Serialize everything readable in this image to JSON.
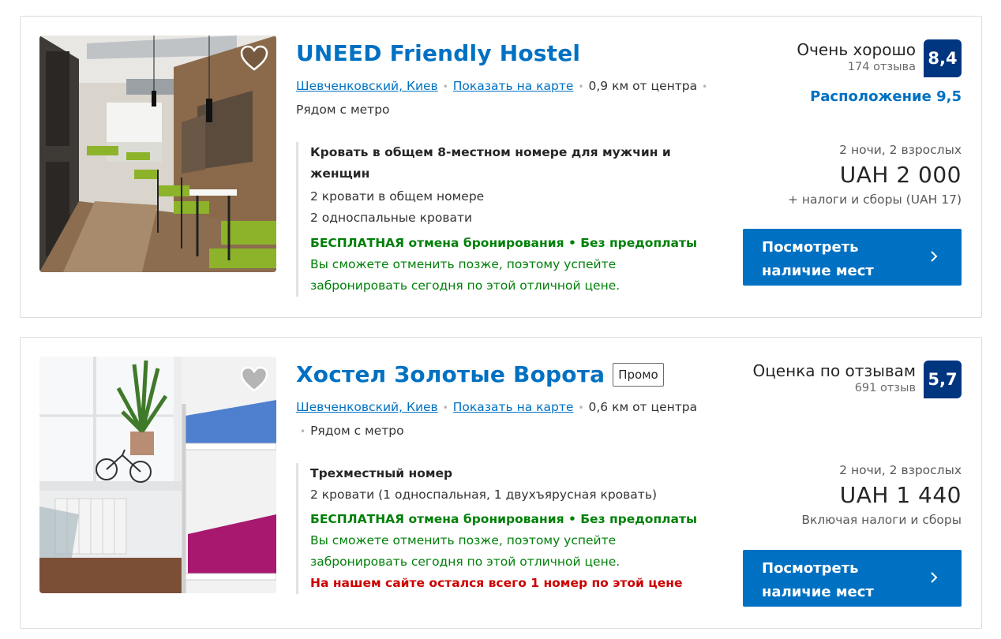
{
  "listings": [
    {
      "name": "UNEED Friendly Hostel",
      "promo": "",
      "district": "Шевченковский, Киев",
      "map_link": "Показать на карте",
      "distance": "0,9 км от центра",
      "metro": "Рядом с метро",
      "room_title": "Кровать в общем 8-местном номере для мужчин и женщин",
      "beds_lines": [
        "2 кровати в общем номере",
        "2 односпальные кровати"
      ],
      "free_cancel": "БЕСПЛАТНАЯ отмена бронирования • Без предоплаты",
      "cancel_note": "Вы сможете отменить позже, поэтому успейте забронировать сегодня по этой отличной цене.",
      "scarcity": "",
      "score_label": "Очень хорошо",
      "review_count": "174 отзыва",
      "score": "8,4",
      "location_score": "Расположение 9,5",
      "nights": "2 ночи, 2 взрослых",
      "price": "UAH 2 000",
      "taxes": "+ налоги и сборы (UAH 17)",
      "cta": "Посмотреть наличие мест",
      "icons": {
        "favorite": "heart-icon",
        "cta": "chevron-right-icon"
      }
    },
    {
      "name": "Хостел Золотые Ворота",
      "promo": "Промо",
      "district": "Шевченковский, Киев",
      "map_link": "Показать на карте",
      "distance": "0,6 км от центра",
      "metro": "Рядом с метро",
      "room_title": "Трехместный номер",
      "beds_lines": [
        "2 кровати (1 односпальная, 1 двухъярусная кровать)"
      ],
      "free_cancel": "БЕСПЛАТНАЯ отмена бронирования • Без предоплаты",
      "cancel_note": "Вы сможете отменить позже, поэтому успейте забронировать сегодня по этой отличной цене.",
      "scarcity": "На нашем сайте остался всего 1 номер по этой цене",
      "score_label": "Оценка по отзывам",
      "review_count": "691 отзыв",
      "score": "5,7",
      "location_score": "",
      "nights": "2 ночи, 2 взрослых",
      "price": "UAH 1 440",
      "taxes": "Включая налоги и сборы",
      "cta": "Посмотреть наличие мест",
      "icons": {
        "favorite": "heart-icon",
        "cta": "chevron-right-icon"
      }
    }
  ],
  "colors": {
    "link": "#0071c2",
    "score_badge": "#003580",
    "free_cancel": "#008009",
    "scarcity": "#cc0000",
    "cta": "#0071c2"
  }
}
